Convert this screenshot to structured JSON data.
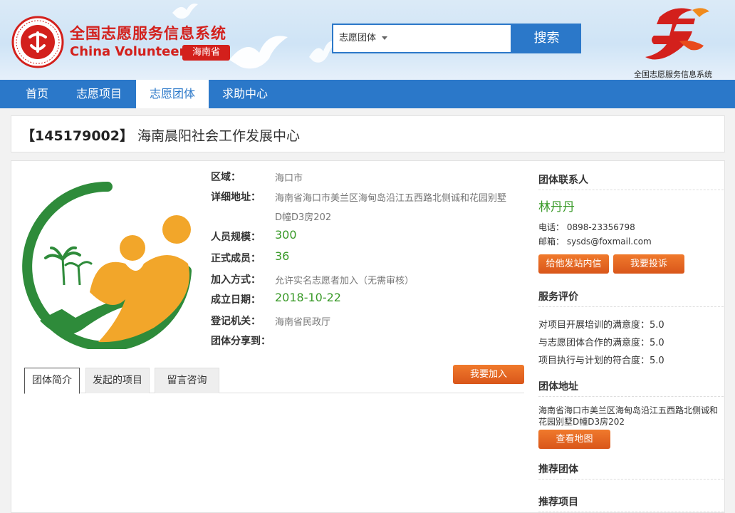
{
  "header": {
    "seal_text": "中国志愿服务 · CHINA VOLUNTEER SERVICE",
    "title_cn": "全国志愿服务信息系统",
    "title_en": "China Volunteer",
    "province": "海南省",
    "brand_text": "全国志愿服务信息系统"
  },
  "search": {
    "category": "志愿团体",
    "button": "搜索"
  },
  "nav": {
    "items": [
      {
        "label": "首页"
      },
      {
        "label": "志愿项目"
      },
      {
        "label": "志愿团体"
      },
      {
        "label": "求助中心"
      }
    ]
  },
  "org": {
    "id": "【145179002】",
    "name": "海南晨阳社会工作发展中心",
    "fields": {
      "region": {
        "label": "区域：",
        "value": "海口市"
      },
      "address": {
        "label": "详细地址：",
        "value_line1": "海南省海口市美兰区海甸岛沿江五西路北侧诚和花园别墅",
        "value_line2": "D幢D3房202"
      },
      "size": {
        "label": "人员规模：",
        "value": "300"
      },
      "members": {
        "label": "正式成员：",
        "value": "36"
      },
      "join_mode": {
        "label": "加入方式：",
        "value": "允许实名志愿者加入（无需审核）"
      },
      "founded": {
        "label": "成立日期：",
        "value": "2018-10-22"
      },
      "registry": {
        "label": "登记机关：",
        "value": "海南省民政厅"
      },
      "share": {
        "label": "团体分享到："
      }
    },
    "tabs": [
      {
        "label": "团体简介"
      },
      {
        "label": "发起的项目"
      },
      {
        "label": "留言咨询"
      }
    ],
    "join_button": "我要加入"
  },
  "sidebar": {
    "contact": {
      "title": "团体联系人",
      "name": "林丹丹",
      "phone": "电话： 0898-23356798",
      "email": "邮箱： sysds@foxmail.com",
      "message_button": "给他发站内信",
      "complain_button": "我要投诉"
    },
    "rating": {
      "title": "服务评价",
      "items": [
        "对项目开展培训的满意度：5.0",
        "与志愿团体合作的满意度：5.0",
        "项目执行与计划的符合度：5.0"
      ]
    },
    "address": {
      "title": "团体地址",
      "line1": "海南省海口市美兰区海甸岛沿江五西路北侧诚和",
      "line2": "花园别墅D幢D3房202",
      "map_button": "查看地图"
    },
    "recommend_orgs": {
      "title": "推荐团体"
    },
    "recommend_projects": {
      "title": "推荐项目"
    }
  },
  "colors": {
    "brand_red": "#d3201c",
    "nav_blue": "#2b78c9",
    "orange": "#e2641f",
    "green": "#3a9a29"
  }
}
